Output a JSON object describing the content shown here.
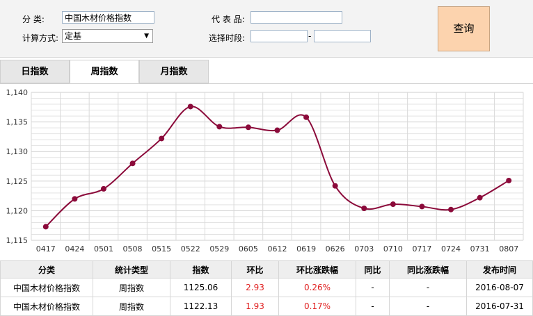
{
  "form": {
    "category_label": "分    类:",
    "category_value": "中国木材价格指数",
    "calc_label": "计算方式:",
    "calc_value": "定基",
    "product_label": "代 表 品:",
    "product_value": "",
    "period_label": "选择时段:",
    "date_from": "",
    "date_sep": "-",
    "date_to": "",
    "query_label": "查询",
    "dropdown_icon": "triangle-down"
  },
  "tabs": [
    {
      "label": "日指数",
      "active": false
    },
    {
      "label": "周指数",
      "active": true
    },
    {
      "label": "月指数",
      "active": false
    }
  ],
  "chart_data": {
    "type": "line",
    "categories": [
      "0417",
      "0424",
      "0501",
      "0508",
      "0515",
      "0522",
      "0529",
      "0605",
      "0612",
      "0619",
      "0626",
      "0703",
      "0710",
      "0717",
      "0724",
      "0731",
      "0807"
    ],
    "values": [
      1117.3,
      1122.0,
      1123.7,
      1128.0,
      1132.2,
      1137.6,
      1134.2,
      1134.1,
      1133.6,
      1135.8,
      1124.2,
      1120.4,
      1121.1,
      1120.7,
      1120.2,
      1122.2,
      1125.1
    ],
    "ylim": [
      1115,
      1140
    ],
    "yticks": [
      "1,115",
      "1,120",
      "1,125",
      "1,130",
      "1,135",
      "1,140"
    ],
    "grid": true,
    "line_color": "#8b0a3a"
  },
  "table": {
    "headers": [
      "分类",
      "统计类型",
      "指数",
      "环比",
      "环比涨跌幅",
      "同比",
      "同比涨跌幅",
      "发布时间"
    ],
    "rows": [
      [
        "中国木材价格指数",
        "周指数",
        "1125.06",
        "2.93",
        "0.26%",
        "-",
        "-",
        "2016-08-07"
      ],
      [
        "中国木材价格指数",
        "周指数",
        "1122.13",
        "1.93",
        "0.17%",
        "-",
        "-",
        "2016-07-31"
      ]
    ],
    "positive_color": "#e02020"
  }
}
